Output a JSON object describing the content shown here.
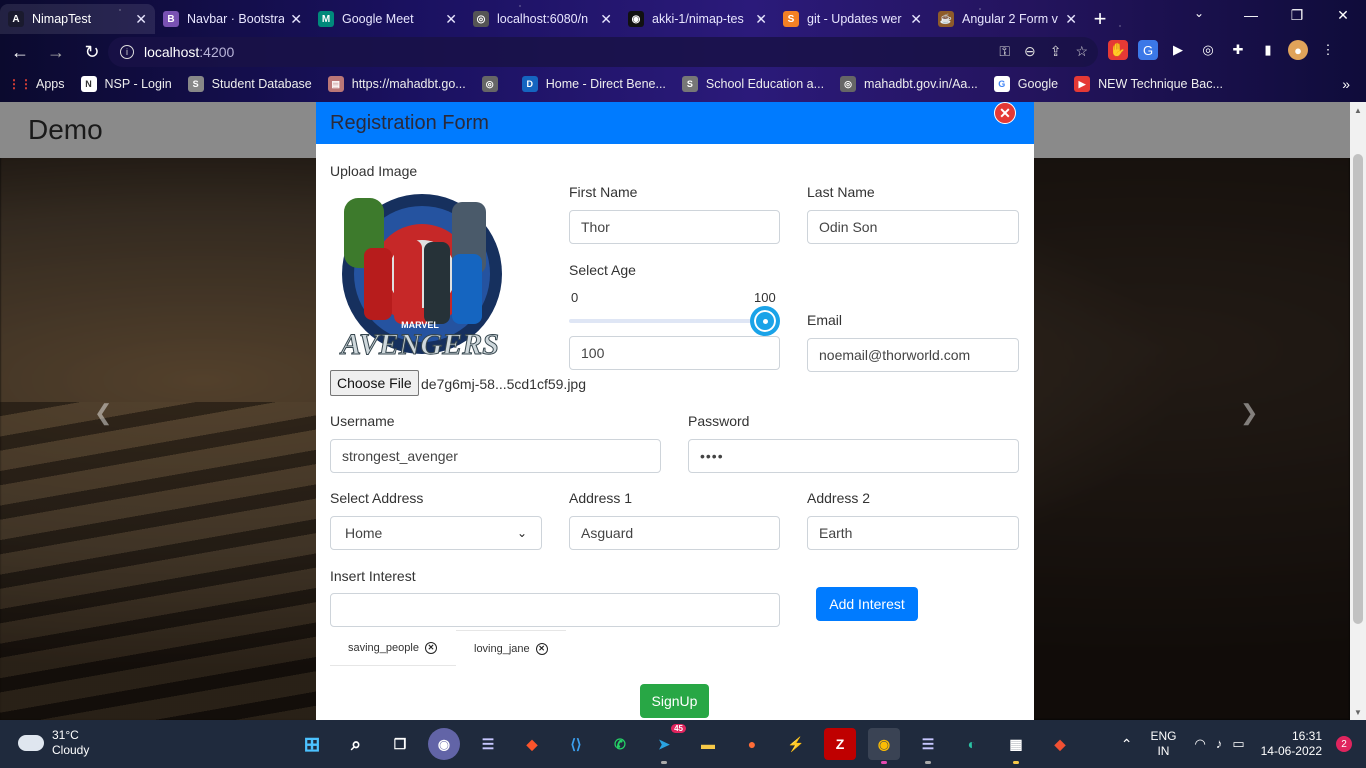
{
  "browser": {
    "tabs": [
      {
        "title": "NimapTest",
        "fav": "A",
        "color": "#1a1a2e"
      },
      {
        "title": "Navbar · Bootstra",
        "fav": "B",
        "color": "#7952b3"
      },
      {
        "title": "Google Meet",
        "fav": "M",
        "color": "#00897b"
      },
      {
        "title": "localhost:6080/n",
        "fav": "◎",
        "color": "#555"
      },
      {
        "title": "akki-1/nimap-tes",
        "fav": "◉",
        "color": "#111"
      },
      {
        "title": "git - Updates wer",
        "fav": "S",
        "color": "#f48024"
      },
      {
        "title": "Angular 2 Form v",
        "fav": "☕",
        "color": "#8e5b2a"
      }
    ],
    "address_host": "localhost",
    "address_port": ":4200",
    "bookmarks": [
      {
        "label": "Apps",
        "icon": "apps-grid-icon",
        "color": "#ea4335"
      },
      {
        "label": "NSP - Login",
        "icon": "nsp-icon",
        "color": "#333"
      },
      {
        "label": "Student Database",
        "icon": "student-icon",
        "color": "#777"
      },
      {
        "label": "https://mahadbt.go...",
        "icon": "page-icon",
        "color": "#b77"
      },
      {
        "label": "",
        "icon": "globe-icon",
        "color": "#666"
      },
      {
        "label": "Home - Direct Bene...",
        "icon": "dbt-icon",
        "color": "#1565c0"
      },
      {
        "label": "School Education a...",
        "icon": "school-icon",
        "color": "#777"
      },
      {
        "label": "mahadbt.gov.in/Aa...",
        "icon": "globe-icon",
        "color": "#666"
      },
      {
        "label": "Google",
        "icon": "google-icon",
        "color": "#fff"
      },
      {
        "label": "NEW Technique Bac...",
        "icon": "youtube-icon",
        "color": "#e53935"
      }
    ]
  },
  "page": {
    "brand": "Demo"
  },
  "modal": {
    "title": "Registration Form",
    "upload_label": "Upload Image",
    "file_button": "Choose File",
    "file_name": "de7g6mj-58...5cd1cf59.jpg",
    "avatar_text": "AVENGERS",
    "avatar_small": "MARVEL",
    "first_name_label": "First Name",
    "first_name_value": "Thor",
    "last_name_label": "Last Name",
    "last_name_value": "Odin Son",
    "age_label": "Select Age",
    "age_min": "0",
    "age_max": "100",
    "age_value": "100",
    "age_fraction": 1.0,
    "email_label": "Email",
    "email_value": "noemail@thorworld.com",
    "username_label": "Username",
    "username_value": "strongest_avenger",
    "password_label": "Password",
    "password_value": "••••",
    "address_select_label": "Select Address",
    "address_select_value": "Home",
    "address1_label": "Address 1",
    "address1_value": "Asguard",
    "address2_label": "Address 2",
    "address2_value": "Earth",
    "interest_label": "Insert Interest",
    "interest_value": "",
    "add_interest_button": "Add Interest",
    "interests": [
      "saving_people",
      "loving_jane"
    ],
    "signup_button": "SignUp"
  },
  "taskbar": {
    "temp": "31°C",
    "weather": "Cloudy",
    "lang1": "ENG",
    "lang2": "IN",
    "time": "16:31",
    "date": "14-06-2022",
    "notifications": "2",
    "telegram_badge": "45"
  },
  "colors": {
    "primary": "#007bff",
    "success": "#28a745",
    "close": "#e53935"
  }
}
